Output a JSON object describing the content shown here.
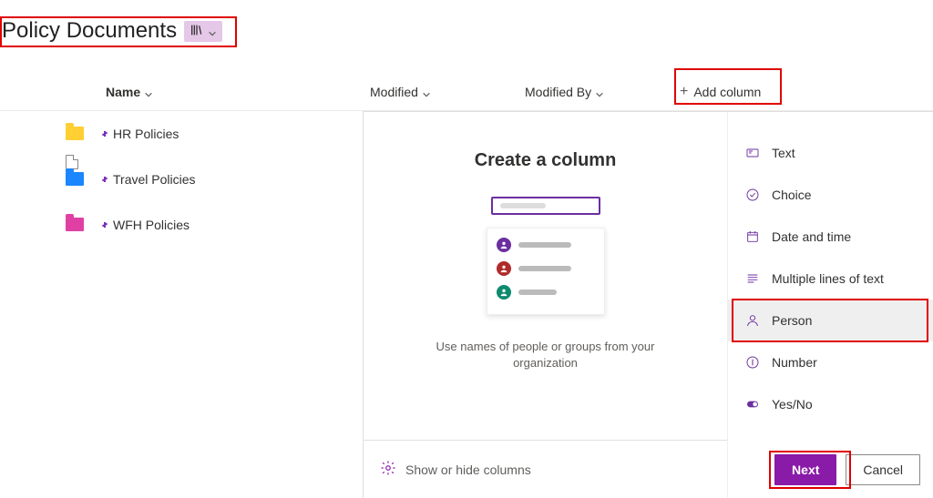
{
  "page": {
    "title": "Policy Documents"
  },
  "columns": {
    "name": "Name",
    "modified": "Modified",
    "modifiedBy": "Modified By",
    "addColumn": "Add column"
  },
  "items": [
    {
      "name": "HR Policies",
      "color": "yellow"
    },
    {
      "name": "Travel Policies",
      "color": "blue"
    },
    {
      "name": "WFH Policies",
      "color": "pink"
    }
  ],
  "panel": {
    "title": "Create a column",
    "description": "Use names of people or groups from your organization",
    "showHide": "Show or hide columns",
    "nextLabel": "Next",
    "cancelLabel": "Cancel"
  },
  "columnTypes": [
    {
      "label": "Text"
    },
    {
      "label": "Choice"
    },
    {
      "label": "Date and time"
    },
    {
      "label": "Multiple lines of text"
    },
    {
      "label": "Person",
      "selected": true
    },
    {
      "label": "Number"
    },
    {
      "label": "Yes/No"
    }
  ]
}
